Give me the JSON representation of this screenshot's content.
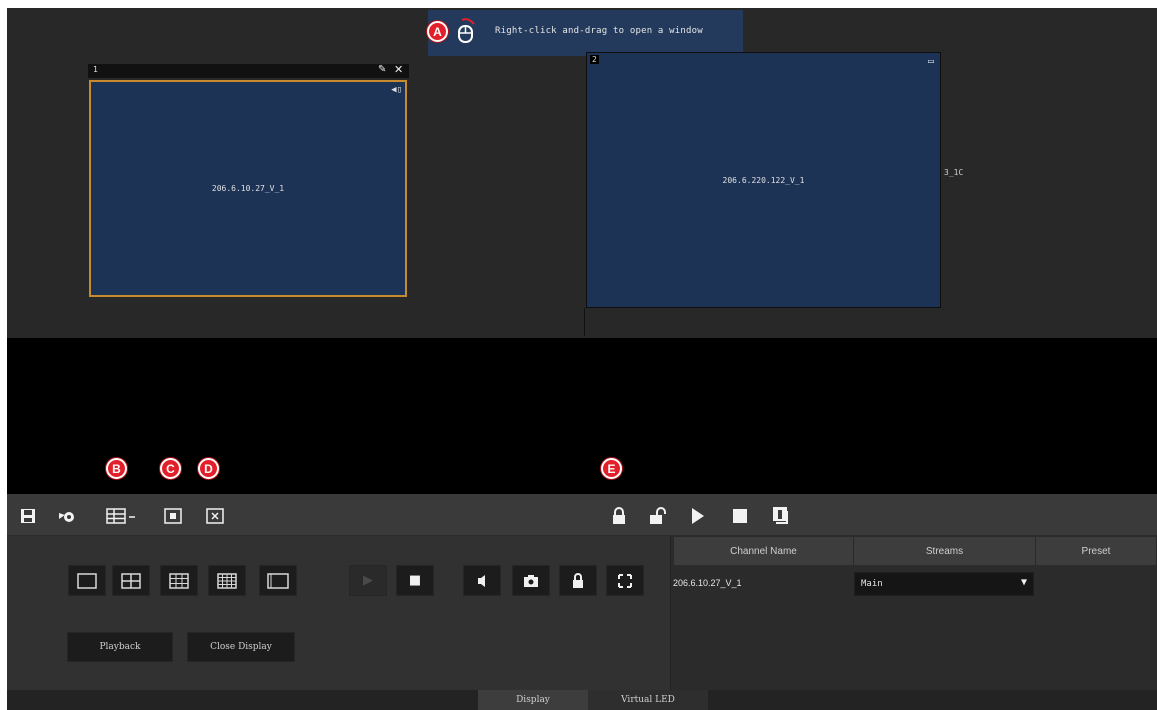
{
  "tooltip": {
    "text": "Right-click and-drag to open a window"
  },
  "callouts": {
    "a": "A",
    "b": "B",
    "c": "C",
    "d": "D",
    "e": "E"
  },
  "windows": [
    {
      "number": "1",
      "label": "206.6.10.27_V_1"
    },
    {
      "number": "2",
      "label": "206.6.220.122_V_1"
    }
  ],
  "canvas": {
    "partial_label": "3_1C"
  },
  "toolbar": {
    "left_icons": [
      "save-icon",
      "settings-icon",
      "layout-split-icon",
      "fullscreen-window-icon",
      "close-window-icon"
    ],
    "right_icons": [
      "lock-icon",
      "unlock-icon",
      "play-icon",
      "stop-icon",
      "info-icon"
    ]
  },
  "controls": {
    "layouts": [
      "1x1",
      "2x2",
      "3x3",
      "4x4",
      "custom"
    ],
    "playback_label": "Playback",
    "close_display_label": "Close Display"
  },
  "table": {
    "headers": [
      "Channel Name",
      "Streams",
      "Preset"
    ],
    "rows": [
      {
        "channel": "206.6.10.27_V_1",
        "stream": "Main"
      }
    ]
  },
  "tabs": [
    "Display",
    "Virtual LED"
  ]
}
